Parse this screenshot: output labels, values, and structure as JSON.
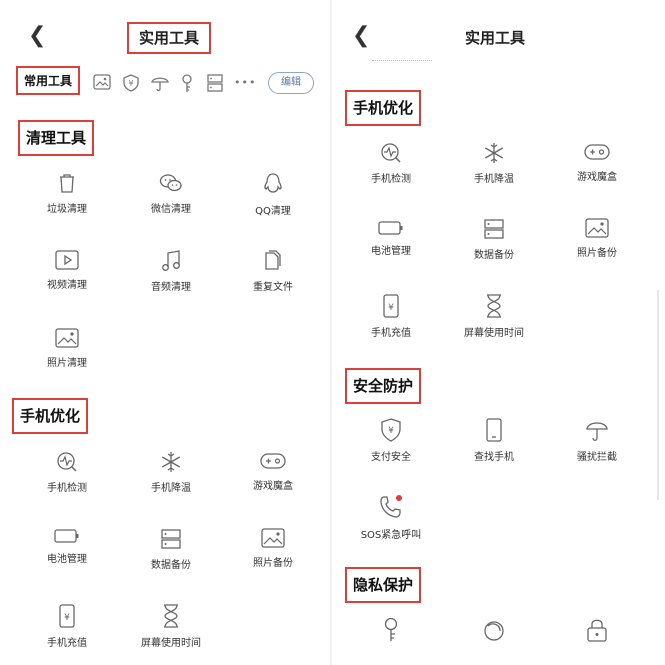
{
  "left": {
    "title": "实用工具",
    "tab_label": "常用工具",
    "edit_label": "编辑",
    "more_label": "•••",
    "sections": [
      {
        "title": "清理工具",
        "items": [
          {
            "label": "垃圾清理",
            "icon": "trash-icon"
          },
          {
            "label": "微信清理",
            "icon": "wechat-icon"
          },
          {
            "label": "QQ清理",
            "icon": "qq-penguin-icon"
          },
          {
            "label": "视频清理",
            "icon": "video-icon"
          },
          {
            "label": "音频清理",
            "icon": "music-note-icon"
          },
          {
            "label": "重复文件",
            "icon": "duplicate-file-icon"
          },
          {
            "label": "照片清理",
            "icon": "photo-icon"
          }
        ]
      },
      {
        "title": "手机优化",
        "items": [
          {
            "label": "手机检测",
            "icon": "phone-check-icon"
          },
          {
            "label": "手机降温",
            "icon": "snowflake-icon"
          },
          {
            "label": "游戏魔盒",
            "icon": "gamepad-icon"
          },
          {
            "label": "电池管理",
            "icon": "battery-icon"
          },
          {
            "label": "数据备份",
            "icon": "data-backup-icon"
          },
          {
            "label": "照片备份",
            "icon": "photo-backup-icon"
          },
          {
            "label": "手机充值",
            "icon": "phone-recharge-icon"
          },
          {
            "label": "屏幕使用时间",
            "icon": "hourglass-icon"
          }
        ]
      }
    ]
  },
  "right": {
    "title": "实用工具",
    "sections": [
      {
        "title": "手机优化",
        "items": [
          {
            "label": "手机检测",
            "icon": "phone-check-icon"
          },
          {
            "label": "手机降温",
            "icon": "snowflake-icon"
          },
          {
            "label": "游戏魔盒",
            "icon": "gamepad-icon"
          },
          {
            "label": "电池管理",
            "icon": "battery-icon"
          },
          {
            "label": "数据备份",
            "icon": "data-backup-icon"
          },
          {
            "label": "照片备份",
            "icon": "photo-backup-icon"
          },
          {
            "label": "手机充值",
            "icon": "phone-recharge-icon"
          },
          {
            "label": "屏幕使用时间",
            "icon": "hourglass-icon"
          }
        ]
      },
      {
        "title": "安全防护",
        "items": [
          {
            "label": "支付安全",
            "icon": "payment-shield-icon"
          },
          {
            "label": "查找手机",
            "icon": "find-phone-icon"
          },
          {
            "label": "骚扰拦截",
            "icon": "umbrella-icon"
          },
          {
            "label": "SOS紧急呼叫",
            "icon": "sos-call-icon"
          }
        ]
      },
      {
        "title": "隐私保护",
        "items": [
          {
            "label": "",
            "icon": "key-icon"
          },
          {
            "label": "",
            "icon": "circle-swirl-icon"
          },
          {
            "label": "",
            "icon": "lock-icon"
          }
        ]
      }
    ]
  },
  "colors": {
    "accent_red": "#d9403a",
    "icon_gray": "#666666",
    "sos_dot": "#e33b3b",
    "edit_blue": "#5a7aa8"
  }
}
